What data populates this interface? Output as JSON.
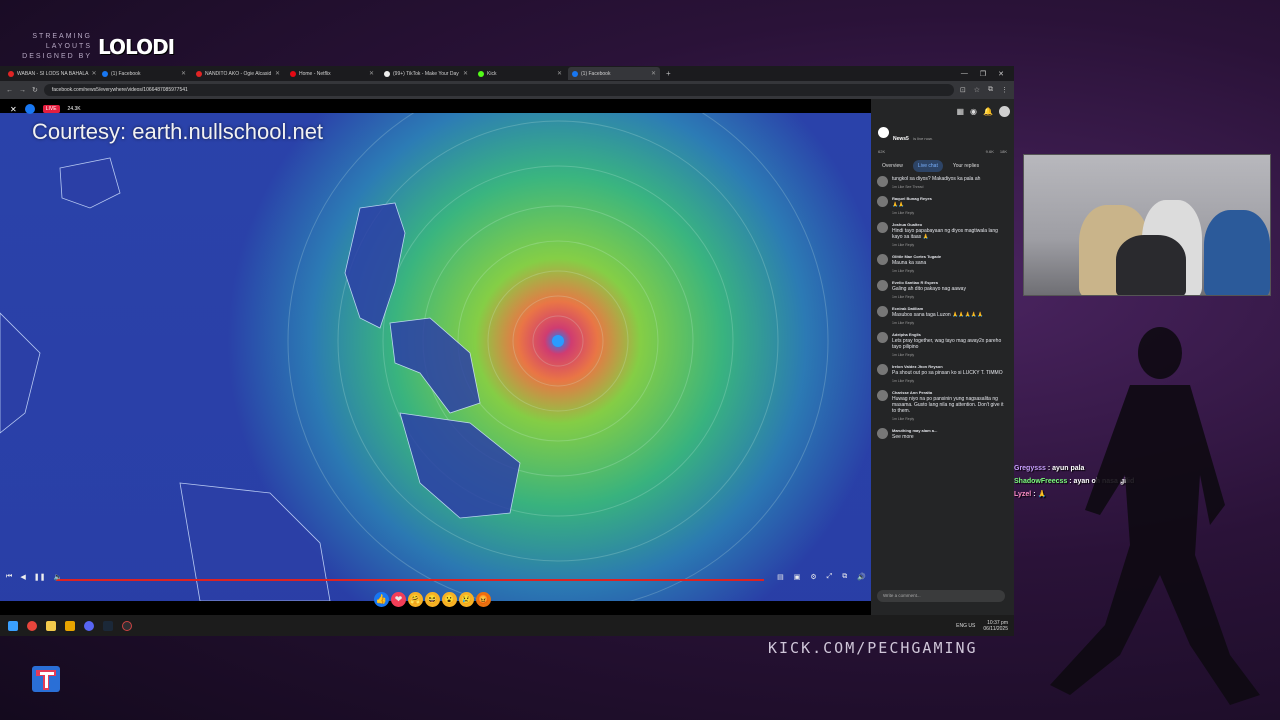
{
  "overlay": {
    "brand_small": "STREAMING LAYOUTS DESIGNED BY",
    "brand_logo": "LOLODI",
    "kick_url": "KICK.COM/PECHGAMING"
  },
  "browser": {
    "tabs": [
      {
        "label": "WABAN - SI LODS NA BAHALA",
        "color": "#e02424",
        "active": false
      },
      {
        "label": "(1) Facebook",
        "color": "#1877f2",
        "active": false
      },
      {
        "label": "NANDITO AKO - Ogie Alcasid",
        "color": "#e02424",
        "active": false
      },
      {
        "label": "Home - Netflix",
        "color": "#e50914",
        "active": false
      },
      {
        "label": "(99+) TikTok - Make Your Day",
        "color": "#eeeeee",
        "active": false
      },
      {
        "label": "Kick",
        "color": "#53fc18",
        "active": false
      },
      {
        "label": "(1) Facebook",
        "color": "#1877f2",
        "active": true
      }
    ],
    "url": "facebook.com/news5/everywhere/videos/1066487085977541"
  },
  "video": {
    "courtesy": "Courtesy: earth.nullschool.net",
    "live_badge": "LIVE",
    "viewer_count": "24.3K"
  },
  "panel": {
    "page_name": "News5",
    "live_status": "is live now.",
    "reaction_count": "62K",
    "comment_count": "9.6K",
    "share_count": "18K",
    "tabs": [
      "Overview",
      "Live chat",
      "Your replies"
    ],
    "active_tab": "Live chat",
    "comments": [
      {
        "author": "",
        "text": "tungkol sa diyos? Makadiyos ka pala ah",
        "meta": "1m  Like  See Thread"
      },
      {
        "author": "Raquel Bunag Reyes",
        "text": "🙏🙏",
        "meta": "1m  Like  Reply"
      },
      {
        "author": "Joshua Gualteo",
        "text": "Hindi tayo papabayaan ng diyos magtiwala lang kayo sa itaas 🙏",
        "meta": "1m  Like  Reply"
      },
      {
        "author": "Glittle Mae Cortes Tugade",
        "text": "Mauna ka sana",
        "meta": "1m  Like  Reply"
      },
      {
        "author": "Evelio Santiao R Espera",
        "text": "Galing ah dito pakayo nag aaway",
        "meta": "1m  Like  Reply"
      },
      {
        "author": "Ecnirak Datiliam",
        "text": "Masubos sana taga Luzon 🙏🙏🙏🙏🙏",
        "meta": "1m  Like  Reply"
      },
      {
        "author": "Adelpha Englis",
        "text": "Lets pray together, wag tayo mag away2x pareho tayo pilipino",
        "meta": "1m  Like  Reply"
      },
      {
        "author": "Irelon Valdez Jhon Reyson",
        "text": "Pa shout out po sa pinsan ko si LUCKY T. TIMMO",
        "meta": "1m  Like  Reply"
      },
      {
        "author": "Charisse Ann Peralta",
        "text": "Huwag niyo na po pansinin yung nagsasalita ng masama. Gusto lang nila ng attention. Don't give it to them.",
        "meta": "1m  Like  Reply"
      },
      {
        "author": "Maruthing may alam a...",
        "text": "See more",
        "meta": ""
      }
    ],
    "compose_placeholder": "Write a comment..."
  },
  "taskbar": {
    "lang": "ENG US",
    "time": "10:37 pm",
    "date": "06/11/2025"
  },
  "overlay_chat": [
    {
      "user": "Gregysss",
      "msg": "ayun pala",
      "color": "#c9a0ff"
    },
    {
      "user": "ShadowFreecss",
      "msg": "ayan oh nasa gilid",
      "color": "#7dff7d"
    },
    {
      "user": "Lyzel",
      "msg": "🙏",
      "color": "#ff8fc7"
    }
  ]
}
